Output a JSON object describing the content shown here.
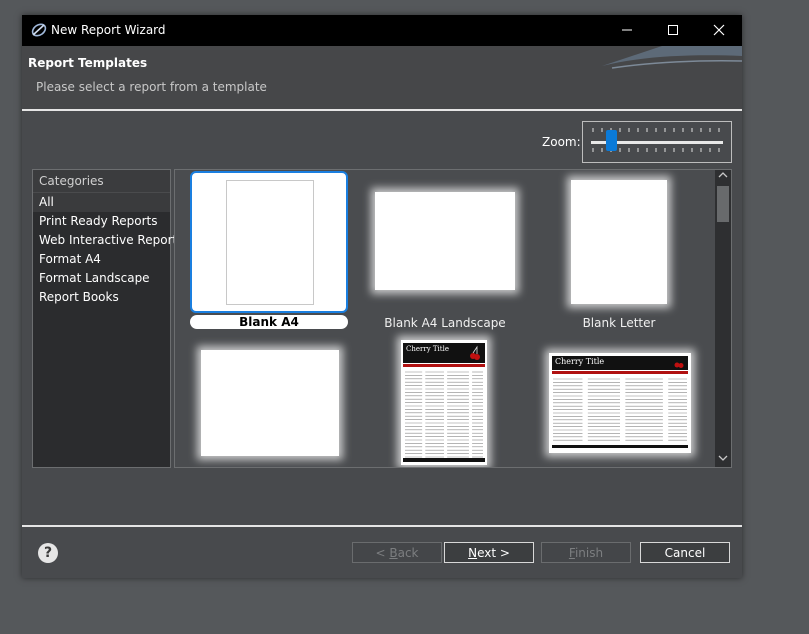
{
  "window": {
    "title": "New Report Wizard",
    "minimize": "—",
    "maximize": "☐",
    "close": "✕"
  },
  "header": {
    "title": "Report Templates",
    "subtitle": "Please select a report from a template"
  },
  "zoom": {
    "label": "Zoom:",
    "level": 0.12
  },
  "categories": {
    "header": "Categories",
    "items": [
      "All",
      "Print Ready Reports",
      "Web Interactive Reports",
      "Format A4",
      "Format Landscape",
      "Report Books"
    ],
    "selected": "All"
  },
  "templates": {
    "items": [
      {
        "label": "Blank A4",
        "selected": true
      },
      {
        "label": "Blank A4 Landscape",
        "selected": false
      },
      {
        "label": "Blank Letter",
        "selected": false
      },
      {
        "label": "",
        "selected": false
      },
      {
        "label": "",
        "selected": false,
        "preview_title": "Cherry Title"
      },
      {
        "label": "",
        "selected": false,
        "preview_title": "Cherry Title"
      }
    ]
  },
  "buttons": {
    "back_prefix": "< ",
    "back_mnemonic": "B",
    "back_rest": "ack",
    "next_mnemonic": "N",
    "next_rest": "ext >",
    "finish_mnemonic": "F",
    "finish_rest": "inish",
    "cancel": "Cancel"
  },
  "help": {
    "glyph": "?"
  },
  "colors": {
    "accent": "#1a7fe0",
    "background": "#484a4d",
    "titlebar": "#000000",
    "preview_red": "#b01010"
  }
}
